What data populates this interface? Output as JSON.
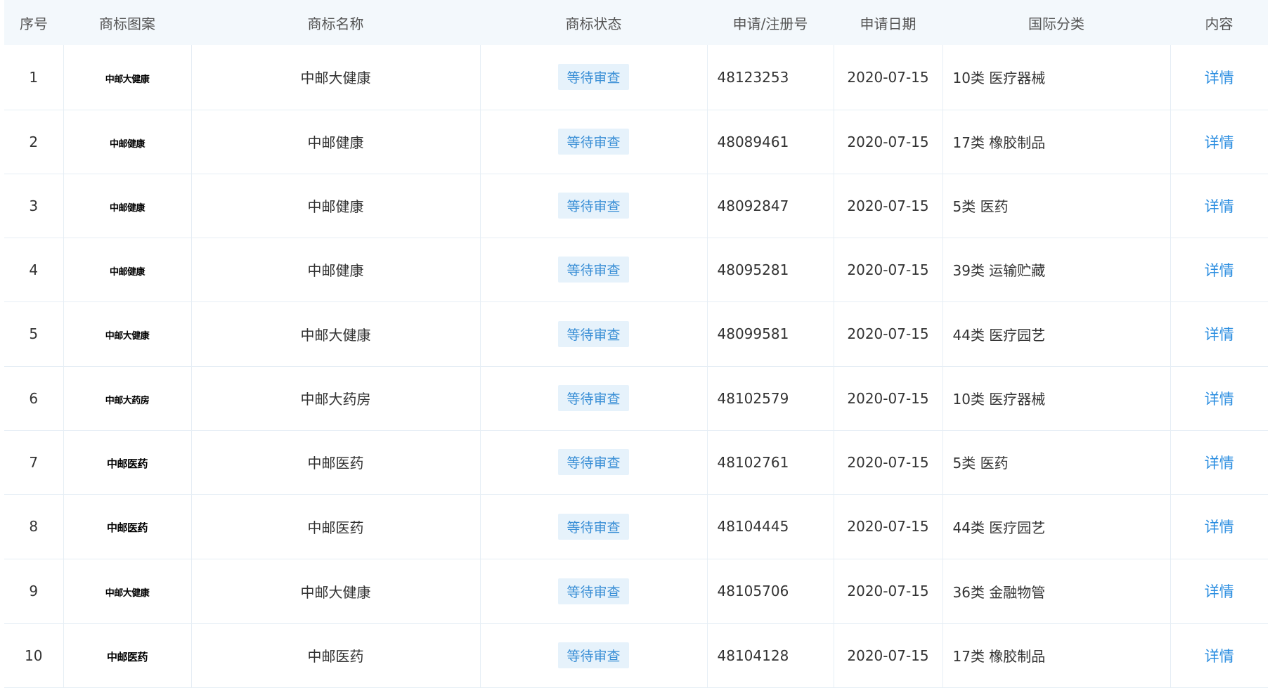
{
  "headers": {
    "index": "序号",
    "logo": "商标图案",
    "name": "商标名称",
    "status": "商标状态",
    "reg_no": "申请/注册号",
    "date": "申请日期",
    "class": "国际分类",
    "content": "内容"
  },
  "rows": [
    {
      "index": "1",
      "logo": "中邮大健康",
      "name": "中邮大健康",
      "status": "等待审查",
      "reg_no": "48123253",
      "date": "2020-07-15",
      "class": "10类 医疗器械",
      "detail": "详情"
    },
    {
      "index": "2",
      "logo": "中邮健康",
      "name": "中邮健康",
      "status": "等待审查",
      "reg_no": "48089461",
      "date": "2020-07-15",
      "class": "17类 橡胶制品",
      "detail": "详情"
    },
    {
      "index": "3",
      "logo": "中邮健康",
      "name": "中邮健康",
      "status": "等待审查",
      "reg_no": "48092847",
      "date": "2020-07-15",
      "class": "5类 医药",
      "detail": "详情"
    },
    {
      "index": "4",
      "logo": "中邮健康",
      "name": "中邮健康",
      "status": "等待审查",
      "reg_no": "48095281",
      "date": "2020-07-15",
      "class": "39类 运输贮藏",
      "detail": "详情"
    },
    {
      "index": "5",
      "logo": "中邮大健康",
      "name": "中邮大健康",
      "status": "等待审查",
      "reg_no": "48099581",
      "date": "2020-07-15",
      "class": "44类 医疗园艺",
      "detail": "详情"
    },
    {
      "index": "6",
      "logo": "中邮大药房",
      "name": "中邮大药房",
      "status": "等待审查",
      "reg_no": "48102579",
      "date": "2020-07-15",
      "class": "10类 医疗器械",
      "detail": "详情"
    },
    {
      "index": "7",
      "logo": "中邮医药",
      "name": "中邮医药",
      "status": "等待审查",
      "reg_no": "48102761",
      "date": "2020-07-15",
      "class": "5类 医药",
      "detail": "详情"
    },
    {
      "index": "8",
      "logo": "中邮医药",
      "name": "中邮医药",
      "status": "等待审查",
      "reg_no": "48104445",
      "date": "2020-07-15",
      "class": "44类 医疗园艺",
      "detail": "详情"
    },
    {
      "index": "9",
      "logo": "中邮大健康",
      "name": "中邮大健康",
      "status": "等待审查",
      "reg_no": "48105706",
      "date": "2020-07-15",
      "class": "36类 金融物管",
      "detail": "详情"
    },
    {
      "index": "10",
      "logo": "中邮医药",
      "name": "中邮医药",
      "status": "等待审查",
      "reg_no": "48104128",
      "date": "2020-07-15",
      "class": "17类 橡胶制品",
      "detail": "详情"
    }
  ],
  "colors": {
    "header_bg": "#f3f8fc",
    "badge_bg": "#e6f2fb",
    "badge_text": "#3a8fd6",
    "link": "#2a8de0",
    "border": "#e6eef5"
  }
}
